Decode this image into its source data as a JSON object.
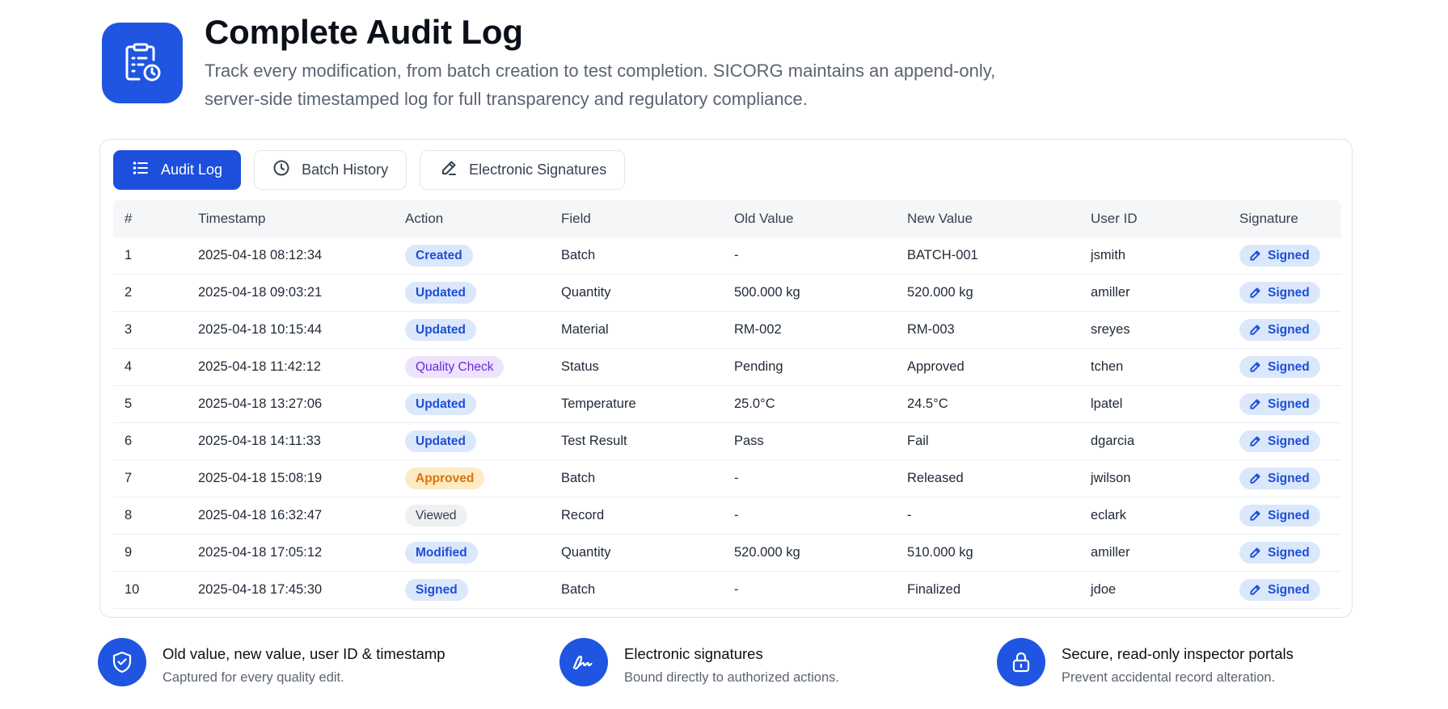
{
  "header": {
    "title": "Complete Audit Log",
    "description": "Track every modification, from batch creation to test completion. SICORG maintains an append-only, server-side timestamped log for full transparency and regulatory compliance.",
    "icon": "clipboard-clock-icon"
  },
  "tabs": [
    {
      "label": "Audit Log",
      "icon": "list-icon",
      "active": true
    },
    {
      "label": "Batch History",
      "icon": "clock-icon",
      "active": false
    },
    {
      "label": "Electronic Signatures",
      "icon": "pen-icon",
      "active": false
    }
  ],
  "table": {
    "columns": [
      "#",
      "Timestamp",
      "Action",
      "Field",
      "Old Value",
      "New Value",
      "User ID",
      "Signature"
    ],
    "rows": [
      {
        "n": "1",
        "ts": "2025-04-18 08:12:34",
        "action": "Created",
        "tone": "blue",
        "field": "Batch",
        "old": "-",
        "new": "BATCH-001",
        "user": "jsmith",
        "sig": "Signed"
      },
      {
        "n": "2",
        "ts": "2025-04-18 09:03:21",
        "action": "Updated",
        "tone": "blue",
        "field": "Quantity",
        "old": "500.000 kg",
        "new": "520.000 kg",
        "user": "amiller",
        "sig": "Signed"
      },
      {
        "n": "3",
        "ts": "2025-04-18 10:15:44",
        "action": "Updated",
        "tone": "blue",
        "field": "Material",
        "old": "RM-002",
        "new": "RM-003",
        "user": "sreyes",
        "sig": "Signed"
      },
      {
        "n": "4",
        "ts": "2025-04-18 11:42:12",
        "action": "Quality Check",
        "tone": "purple",
        "field": "Status",
        "old": "Pending",
        "new": "Approved",
        "user": "tchen",
        "sig": "Signed"
      },
      {
        "n": "5",
        "ts": "2025-04-18 13:27:06",
        "action": "Updated",
        "tone": "blue",
        "field": "Temperature",
        "old": "25.0°C",
        "new": "24.5°C",
        "user": "lpatel",
        "sig": "Signed"
      },
      {
        "n": "6",
        "ts": "2025-04-18 14:11:33",
        "action": "Updated",
        "tone": "blue",
        "field": "Test Result",
        "old": "Pass",
        "new": "Fail",
        "user": "dgarcia",
        "sig": "Signed"
      },
      {
        "n": "7",
        "ts": "2025-04-18 15:08:19",
        "action": "Approved",
        "tone": "amber",
        "field": "Batch",
        "old": "-",
        "new": "Released",
        "user": "jwilson",
        "sig": "Signed"
      },
      {
        "n": "8",
        "ts": "2025-04-18 16:32:47",
        "action": "Viewed",
        "tone": "gray",
        "field": "Record",
        "old": "-",
        "new": "-",
        "user": "eclark",
        "sig": "Signed"
      },
      {
        "n": "9",
        "ts": "2025-04-18 17:05:12",
        "action": "Modified",
        "tone": "blue",
        "field": "Quantity",
        "old": "520.000 kg",
        "new": "510.000 kg",
        "user": "amiller",
        "sig": "Signed"
      },
      {
        "n": "10",
        "ts": "2025-04-18 17:45:30",
        "action": "Signed",
        "tone": "blue",
        "field": "Batch",
        "old": "-",
        "new": "Finalized",
        "user": "jdoe",
        "sig": "Signed"
      }
    ]
  },
  "features": [
    {
      "icon": "shield-check-icon",
      "title": "Old value, new value, user ID & timestamp",
      "subtitle": "Captured for every quality edit."
    },
    {
      "icon": "signature-icon",
      "title": "Electronic signatures",
      "subtitle": "Bound directly to authorized actions."
    },
    {
      "icon": "lock-icon",
      "title": "Secure, read-only inspector portals",
      "subtitle": "Prevent accidental record alteration."
    }
  ],
  "colors": {
    "primary": "#1f55e0",
    "pill_blue_bg": "#dbe8fc",
    "pill_blue_text": "#1d4ed8",
    "pill_purple_bg": "#ede3fd",
    "pill_purple_text": "#6d28d9",
    "pill_amber_bg": "#fdebc4",
    "pill_amber_text": "#d9730d",
    "pill_gray_bg": "#eef0f3"
  }
}
